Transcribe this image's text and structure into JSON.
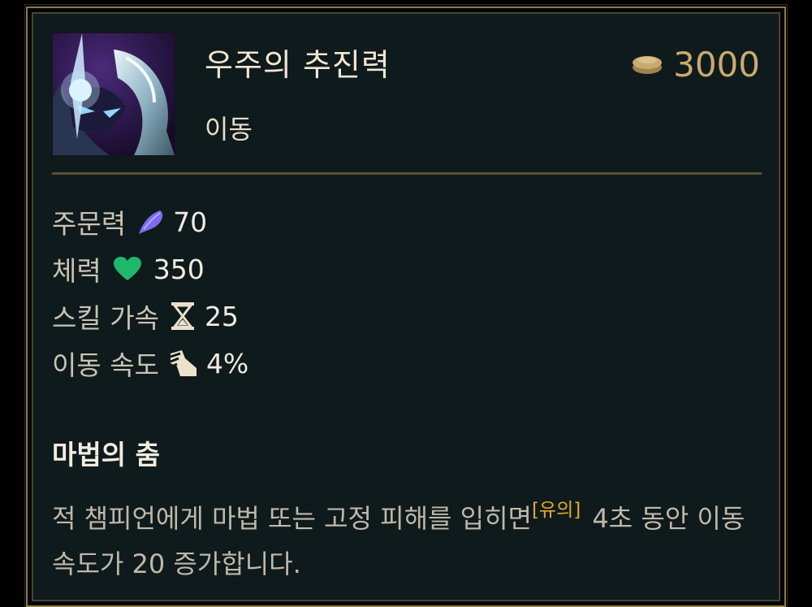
{
  "item": {
    "name": "우주의 추진력",
    "category": "이동",
    "cost": "3000",
    "icon": "cosmic-drive-icon"
  },
  "stats": [
    {
      "label": "주문력",
      "icon": "ability-power-icon",
      "value": "70"
    },
    {
      "label": "체력",
      "icon": "health-heart-icon",
      "value": "350"
    },
    {
      "label": "스킬 가속",
      "icon": "ability-haste-hourglass-icon",
      "value": "25"
    },
    {
      "label": "이동 속도",
      "icon": "movement-speed-boot-icon",
      "value": "4%"
    }
  ],
  "passive": {
    "title": "마법의 춤",
    "desc_before": "적 챔피언에게 마법 또는 고정 피해를 입히면",
    "note": "[유의]",
    "desc_after": " 4초 동안 이동 속도가 20 증가합니다."
  },
  "colors": {
    "gold": "#c8aa6e",
    "note": "#e0a82e",
    "ap": "#7b6cf0",
    "health": "#1fb86a",
    "background": "#0f1a1c",
    "border": "#8e7a4f"
  }
}
